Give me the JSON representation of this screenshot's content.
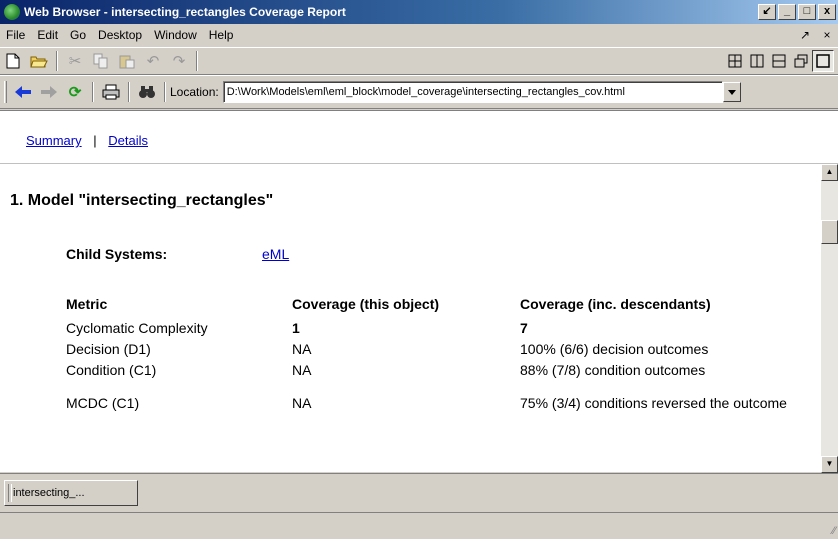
{
  "window": {
    "title": "Web Browser - intersecting_rectangles Coverage Report",
    "controls": [
      "↙",
      "_",
      "□",
      "x"
    ]
  },
  "menubar": {
    "items": [
      "File",
      "Edit",
      "Go",
      "Desktop",
      "Window",
      "Help"
    ],
    "right": [
      "↗",
      "×"
    ]
  },
  "toolbar": {
    "icons": [
      "new-page-icon",
      "open-folder-icon",
      "cut-icon",
      "copy-icon",
      "paste-icon",
      "undo-icon",
      "redo-icon"
    ],
    "layout_icons": [
      "tile-grid-icon",
      "tile-vertical-icon",
      "tile-horizontal-icon",
      "float-icon",
      "maximize-icon"
    ]
  },
  "nav": {
    "location_label": "Location:",
    "location_value": "D:\\Work\\Models\\eml\\eml_block\\model_coverage\\intersecting_rectangles_cov.html"
  },
  "links": {
    "summary": "Summary",
    "separator": "|",
    "details": "Details"
  },
  "report": {
    "heading": "1. Model \"intersecting_rectangles\"",
    "child_label": "Child Systems:",
    "child_link": "eML",
    "headers": [
      "Metric",
      "Coverage (this object)",
      "Coverage (inc. descendants)"
    ],
    "rows": [
      {
        "metric": "Cyclomatic Complexity",
        "this": "1",
        "inc": "7"
      },
      {
        "metric": "Decision (D1)",
        "this": "NA",
        "inc": "100% (6/6) decision outcomes"
      },
      {
        "metric": "Condition (C1)",
        "this": "NA",
        "inc": "88% (7/8) condition outcomes"
      },
      {
        "metric": "MCDC (C1)",
        "this": "NA",
        "inc": "75% (3/4) conditions reversed the outcome"
      }
    ]
  },
  "tabs": {
    "doc_tab": "intersecting_..."
  }
}
